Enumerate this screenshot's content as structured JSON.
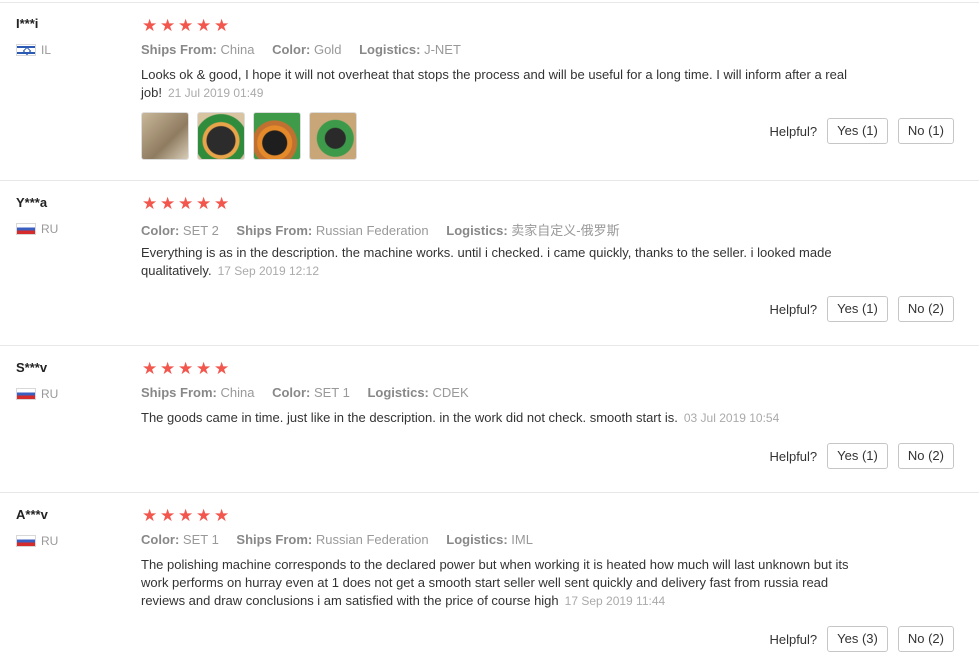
{
  "colors": {
    "star": "#f2564c",
    "divider": "#e8e8e8",
    "meta": "#999999"
  },
  "helpful_label": "Helpful?",
  "reviews": [
    {
      "user": "I***i",
      "country": "IL",
      "rating": 5,
      "meta": [
        {
          "key": "Ships From:",
          "value": "China"
        },
        {
          "key": "Color:",
          "value": "Gold"
        },
        {
          "key": "Logistics:",
          "value": "J-NET"
        }
      ],
      "text": "Looks ok & good, I hope it will not overheat that stops the process and will be useful for a long time. I will inform after a real job!",
      "date": "21 Jul 2019 01:49",
      "images": [
        "photo-box",
        "photo-disc-green",
        "photo-disc-orange",
        "photo-tool"
      ],
      "yes": "Yes (1)",
      "no": "No (1)"
    },
    {
      "user": "Y***a",
      "country": "RU",
      "rating": 5,
      "meta": [
        {
          "key": "Color:",
          "value": "SET 2"
        },
        {
          "key": "Ships From:",
          "value": "Russian Federation"
        },
        {
          "key": "Logistics:",
          "value": "卖家自定义-俄罗斯"
        }
      ],
      "text": "Everything is as in the description. the machine works. until i checked. i came quickly, thanks to the seller. i looked made qualitatively.",
      "date": "17 Sep 2019 12:12",
      "yes": "Yes (1)",
      "no": "No (2)"
    },
    {
      "user": "S***v",
      "country": "RU",
      "rating": 5,
      "meta": [
        {
          "key": "Ships From:",
          "value": "China"
        },
        {
          "key": "Color:",
          "value": "SET 1"
        },
        {
          "key": "Logistics:",
          "value": "CDEK"
        }
      ],
      "text": "The goods came in time. just like in the description. in the work did not check. smooth start is.",
      "date": "03 Jul 2019 10:54",
      "yes": "Yes (1)",
      "no": "No (2)"
    },
    {
      "user": "A***v",
      "country": "RU",
      "rating": 5,
      "meta": [
        {
          "key": "Color:",
          "value": "SET 1"
        },
        {
          "key": "Ships From:",
          "value": "Russian Federation"
        },
        {
          "key": "Logistics:",
          "value": "IML"
        }
      ],
      "text": "The polishing machine corresponds to the declared power but when working it is heated how much will last unknown but its work performs on hurray even at 1 does not get a smooth start seller well sent quickly and delivery fast from russia read reviews and draw conclusions i am satisfied with the price of course high",
      "date": "17 Sep 2019 11:44",
      "yes": "Yes (3)",
      "no": "No (2)"
    }
  ]
}
